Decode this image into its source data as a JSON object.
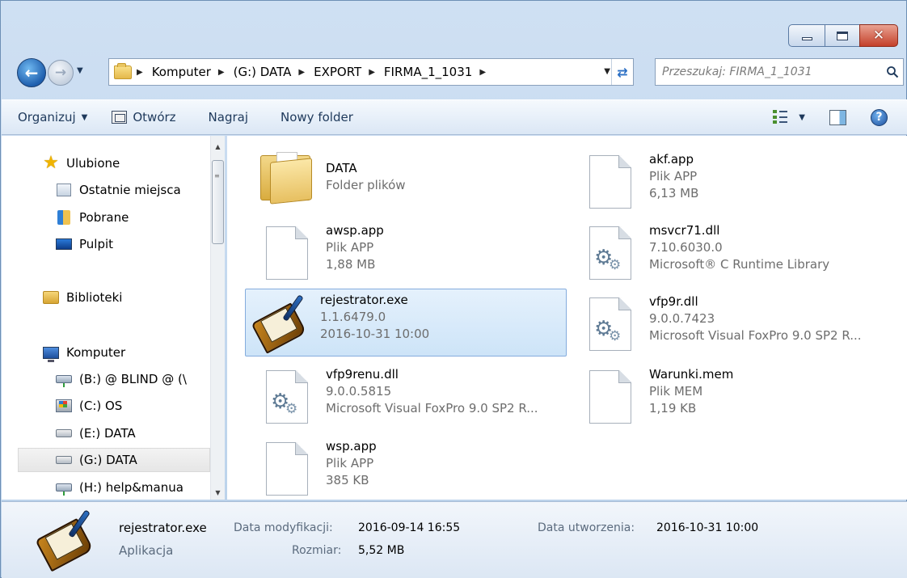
{
  "window": {
    "caption_buttons": {
      "minimize": "",
      "maximize": "",
      "close": "✕"
    }
  },
  "navigation": {
    "breadcrumbs": [
      "Komputer",
      "(G:) DATA",
      "EXPORT",
      "FIRMA_1_1031"
    ],
    "search_placeholder": "Przeszukaj: FIRMA_1_1031"
  },
  "toolbar": {
    "organize": "Organizuj",
    "open": "Otwórz",
    "burn": "Nagraj",
    "new_folder": "Nowy folder"
  },
  "nav_pane": {
    "items": [
      {
        "label": "Ulubione",
        "icon": "star-icon"
      },
      {
        "label": "Ostatnie miejsca",
        "icon": "recent-places-icon"
      },
      {
        "label": "Pobrane",
        "icon": "downloads-icon"
      },
      {
        "label": "Pulpit",
        "icon": "desktop-icon"
      },
      {
        "label": "Biblioteki",
        "icon": "libraries-icon"
      },
      {
        "label": "Komputer",
        "icon": "computer-icon"
      },
      {
        "label": "(B:) @ BLIND @ (\\",
        "icon": "network-drive-icon"
      },
      {
        "label": "(C:) OS",
        "icon": "os-drive-icon"
      },
      {
        "label": "(E:) DATA",
        "icon": "drive-icon"
      },
      {
        "label": "(G:) DATA",
        "icon": "drive-icon"
      },
      {
        "label": "(H:) help&manua",
        "icon": "network-drive-icon"
      }
    ],
    "selected_index": 9
  },
  "files": [
    {
      "name": "DATA",
      "line2": "Folder plików",
      "line3": "",
      "icon": "folder-icon"
    },
    {
      "name": "akf.app",
      "line2": "Plik APP",
      "line3": "6,13 MB",
      "icon": "document-icon"
    },
    {
      "name": "awsp.app",
      "line2": "Plik APP",
      "line3": "1,88 MB",
      "icon": "document-icon"
    },
    {
      "name": "msvcr71.dll",
      "line2": "7.10.6030.0",
      "line3": "Microsoft® C Runtime Library",
      "icon": "dll-gear-icon"
    },
    {
      "name": "rejestrator.exe",
      "line2": "1.1.6479.0",
      "line3": "2016-10-31 10:00",
      "icon": "application-icon"
    },
    {
      "name": "vfp9r.dll",
      "line2": "9.0.0.7423",
      "line3": "Microsoft Visual FoxPro 9.0 SP2 R...",
      "icon": "dll-gear-icon"
    },
    {
      "name": "vfp9renu.dll",
      "line2": "9.0.0.5815",
      "line3": "Microsoft Visual FoxPro 9.0 SP2 R...",
      "icon": "dll-gear-icon"
    },
    {
      "name": "Warunki.mem",
      "line2": "Plik MEM",
      "line3": "1,19 KB",
      "icon": "document-icon"
    },
    {
      "name": "wsp.app",
      "line2": "Plik APP",
      "line3": "385 KB",
      "icon": "document-icon"
    }
  ],
  "selected_file": "rejestrator.exe",
  "details": {
    "name": "rejestrator.exe",
    "type": "Aplikacja",
    "modified_label": "Data modyfikacji:",
    "modified_value": "2016-09-14 16:55",
    "created_label": "Data utworzenia:",
    "created_value": "2016-10-31 10:00",
    "size_label": "Rozmiar:",
    "size_value": "5,52 MB"
  }
}
